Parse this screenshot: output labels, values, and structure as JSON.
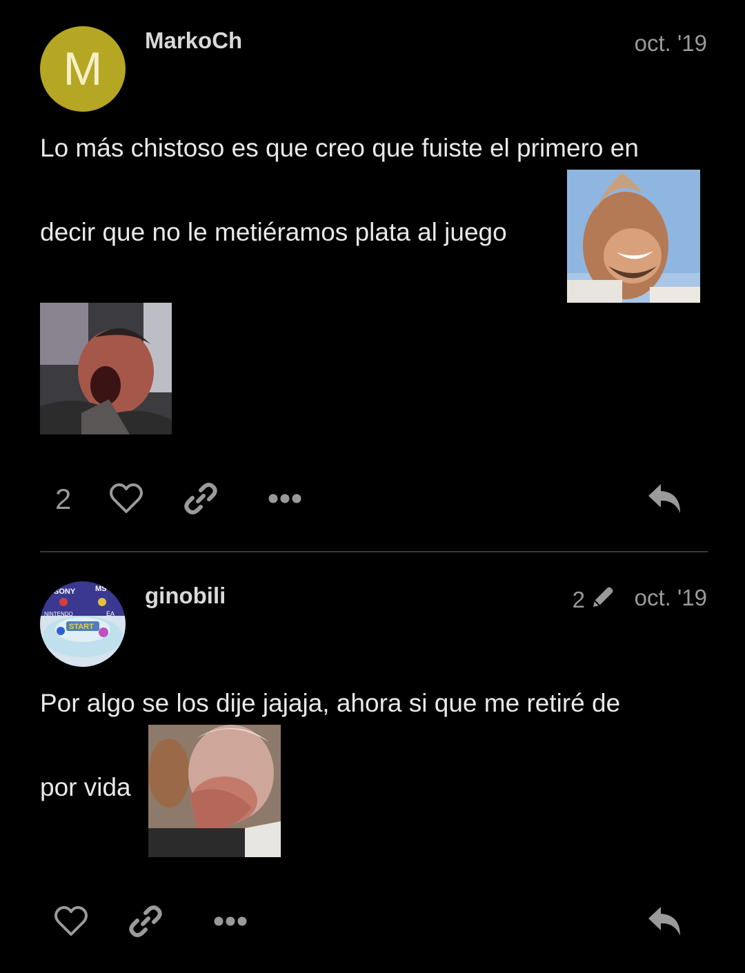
{
  "posts": [
    {
      "username": "MarkoCh",
      "avatar_letter": "M",
      "date": "oct. '19",
      "text_line1": "Lo más chistoso es que creo que fuiste el primero en",
      "text_line2": "decir que no le metiéramos plata al juego",
      "like_count": "2"
    },
    {
      "username": "ginobili",
      "edit_count": "2",
      "date": "oct. '19",
      "text_line1": "Por algo se los dije jajaja, ahora si que me retiré de",
      "text_line2": "por vida",
      "avatar_text_top_left": "SONY",
      "avatar_text_top_right": "MS",
      "avatar_text_mid_left": "NINTENDO",
      "avatar_text_mid_right": "EA",
      "avatar_text_start": "START"
    }
  ],
  "icons": {
    "like": "heart-icon",
    "link": "link-icon",
    "more": "ellipsis-icon",
    "reply": "reply-icon",
    "edit": "pencil-icon"
  },
  "colors": {
    "background": "#000000",
    "avatar_m": "#b5a624",
    "muted": "#9a9a9a"
  }
}
